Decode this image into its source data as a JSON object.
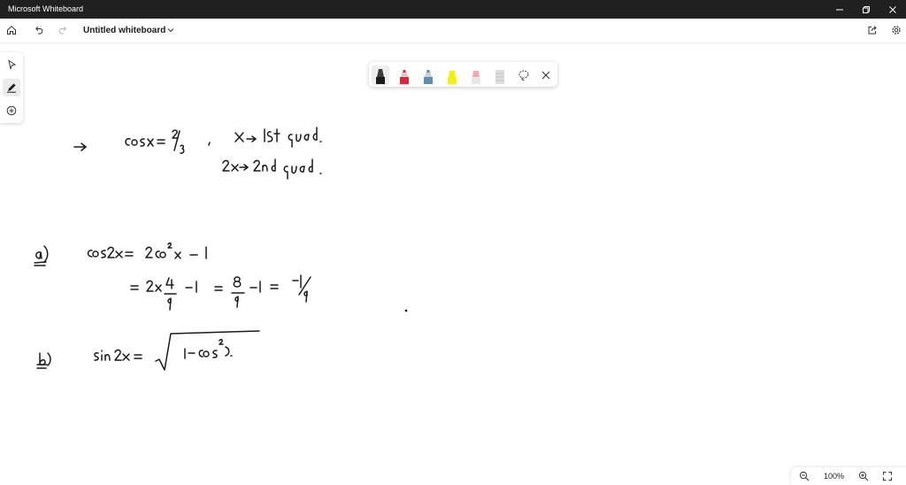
{
  "window": {
    "app_title": "Microsoft Whiteboard"
  },
  "toolbar": {
    "board_title": "Untitled whiteboard"
  },
  "pen_palette": {
    "pens": [
      {
        "name": "black-pen",
        "color": "#1b1b1b",
        "selected": true
      },
      {
        "name": "red-pen",
        "color": "#e0243b",
        "selected": false
      },
      {
        "name": "blue-pen",
        "color": "#5b8fb3",
        "selected": false
      },
      {
        "name": "yellow-highlighter",
        "color": "#f2ee1a",
        "selected": false
      },
      {
        "name": "pink-highlighter",
        "color": "#f4a7b5",
        "selected": false
      },
      {
        "name": "eraser",
        "color": "#c9c9c9",
        "selected": false
      }
    ]
  },
  "zoom": {
    "level": "100%"
  },
  "colors": {
    "titlebar_bg": "#202020",
    "ink": "#1b1b1b",
    "canvas_bg": "#ffffff"
  }
}
